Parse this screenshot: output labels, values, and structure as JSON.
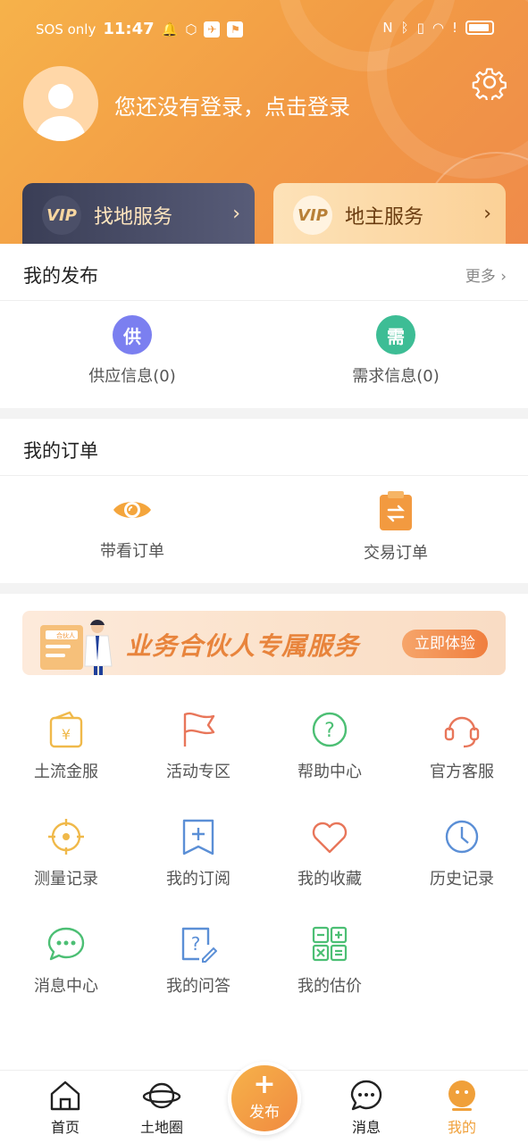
{
  "statusbar": {
    "carrier": "SOS only",
    "time": "11:47"
  },
  "profile": {
    "login_prompt": "您还没有登录，点击登录"
  },
  "vip": [
    {
      "label": "找地服务",
      "badge": "VIP"
    },
    {
      "label": "地主服务",
      "badge": "VIP"
    }
  ],
  "my_posts": {
    "title": "我的发布",
    "more": "更多",
    "items": [
      {
        "icon_char": "供",
        "label": "供应信息(0)",
        "color": "#7b7ff0"
      },
      {
        "icon_char": "需",
        "label": "需求信息(0)",
        "color": "#3dbd95"
      }
    ]
  },
  "my_orders": {
    "title": "我的订单",
    "items": [
      {
        "label": "带看订单"
      },
      {
        "label": "交易订单"
      }
    ]
  },
  "banner": {
    "text": "业务合伙人专属服务",
    "button": "立即体验",
    "card_label": "合伙人"
  },
  "services": [
    {
      "label": "土流金服",
      "icon": "wallet-icon"
    },
    {
      "label": "活动专区",
      "icon": "flag-icon"
    },
    {
      "label": "帮助中心",
      "icon": "help-icon"
    },
    {
      "label": "官方客服",
      "icon": "headset-icon"
    },
    {
      "label": "测量记录",
      "icon": "target-icon"
    },
    {
      "label": "我的订阅",
      "icon": "bookmark-icon"
    },
    {
      "label": "我的收藏",
      "icon": "heart-icon"
    },
    {
      "label": "历史记录",
      "icon": "clock-icon"
    },
    {
      "label": "消息中心",
      "icon": "chat-icon"
    },
    {
      "label": "我的问答",
      "icon": "qa-icon"
    },
    {
      "label": "我的估价",
      "icon": "calculator-icon"
    }
  ],
  "tabbar": {
    "home": "首页",
    "land_circle": "土地圈",
    "publish": "发布",
    "messages": "消息",
    "mine": "我的"
  },
  "colors": {
    "accent": "#f0a03a",
    "header_start": "#f6b24a",
    "header_end": "#ef8a4a"
  }
}
